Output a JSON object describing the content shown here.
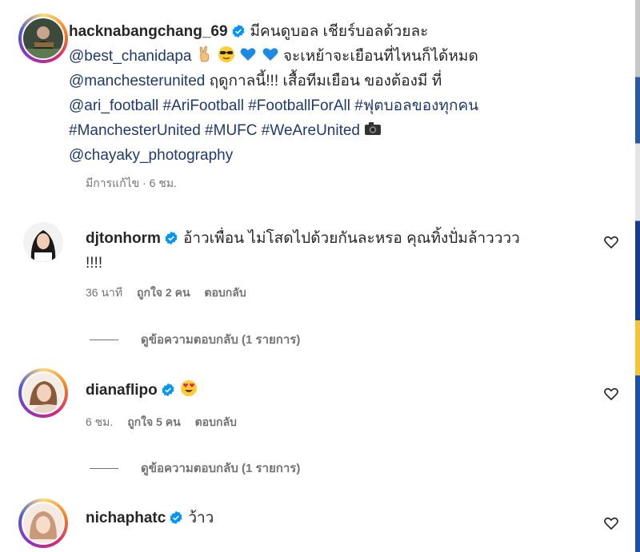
{
  "post": {
    "username": "hacknabangchang_69",
    "caption_1": "มีคนดูบอล เชียร์บอลด้วยละ",
    "mention_1": "@best_chanidapa",
    "caption_2": "จะเหย้าจะเยือนที่ไหนก็ได้หมด",
    "mention_2": "@manchesterunited",
    "caption_3": "ฤดูกาลนี้!!! เสื้อทีมเยือน ของต้องมี ที่",
    "mention_3": "@ari_football",
    "tag_1": "#AriFootball",
    "tag_2": "#FootballForAll",
    "tag_3": "#ฟุตบอลของทุกคน",
    "tag_4": "#ManchesterUnited",
    "tag_5": "#MUFC",
    "tag_6": "#WeAreUnited",
    "mention_4": "@chayaky_photography",
    "meta": "มีการแก้ไข · 6 ชม."
  },
  "comments": [
    {
      "username": "djtonhorm",
      "text": "อ้าวเพื่อน ไม่โสดไปด้วยกันละหรอ คุณทิ้งปั่มล้าวววว",
      "text_2": "!!!!",
      "time": "36 นาที",
      "likes": "ถูกใจ 2 คน",
      "reply": "ตอบกลับ",
      "view_replies": "ดูข้อความตอบกลับ (1 รายการ)"
    },
    {
      "username": "dianaflipo",
      "emoji": "heart-eyes",
      "time": "6 ชม.",
      "likes": "ถูกใจ 5 คน",
      "reply": "ตอบกลับ",
      "view_replies": "ดูข้อความตอบกลับ (1 รายการ)"
    },
    {
      "username": "nichaphatc",
      "text": "ว้าว"
    }
  ],
  "colors": {
    "verified": "#0095f6",
    "link": "#1e3a6e",
    "muted": "#737373"
  }
}
